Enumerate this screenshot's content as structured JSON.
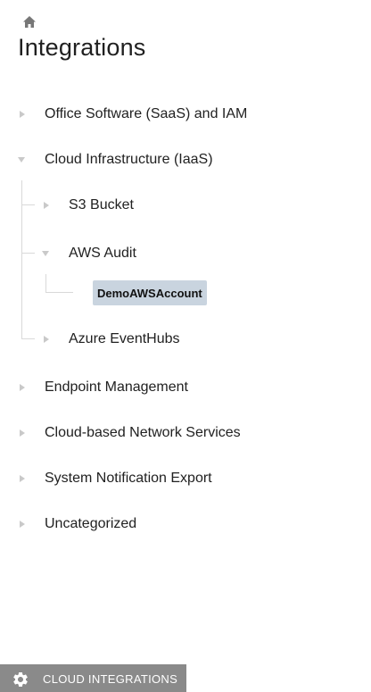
{
  "header": {
    "home_icon": "home-icon",
    "title": "Integrations"
  },
  "tree": {
    "categories": [
      {
        "label": "Office Software (SaaS) and IAM",
        "expanded": false
      },
      {
        "label": "Cloud Infrastructure (IaaS)",
        "expanded": true,
        "children": [
          {
            "label": "S3 Bucket",
            "expanded": false
          },
          {
            "label": "AWS Audit",
            "expanded": true,
            "children": [
              {
                "label": "DemoAWSAccount",
                "selected": true
              }
            ]
          },
          {
            "label": "Azure EventHubs",
            "expanded": false
          }
        ]
      },
      {
        "label": "Endpoint Management",
        "expanded": false
      },
      {
        "label": "Cloud-based Network Services",
        "expanded": false
      },
      {
        "label": "System Notification Export",
        "expanded": false
      },
      {
        "label": "Uncategorized",
        "expanded": false
      }
    ]
  },
  "footer": {
    "icon": "gear-icon",
    "label": "CLOUD INTEGRATIONS"
  },
  "colors": {
    "selected_chip_bg": "#c9d4df",
    "footer_bg": "#8a8a8a",
    "caret": "#c9c9c9",
    "tree_line": "#d9d9d9"
  }
}
